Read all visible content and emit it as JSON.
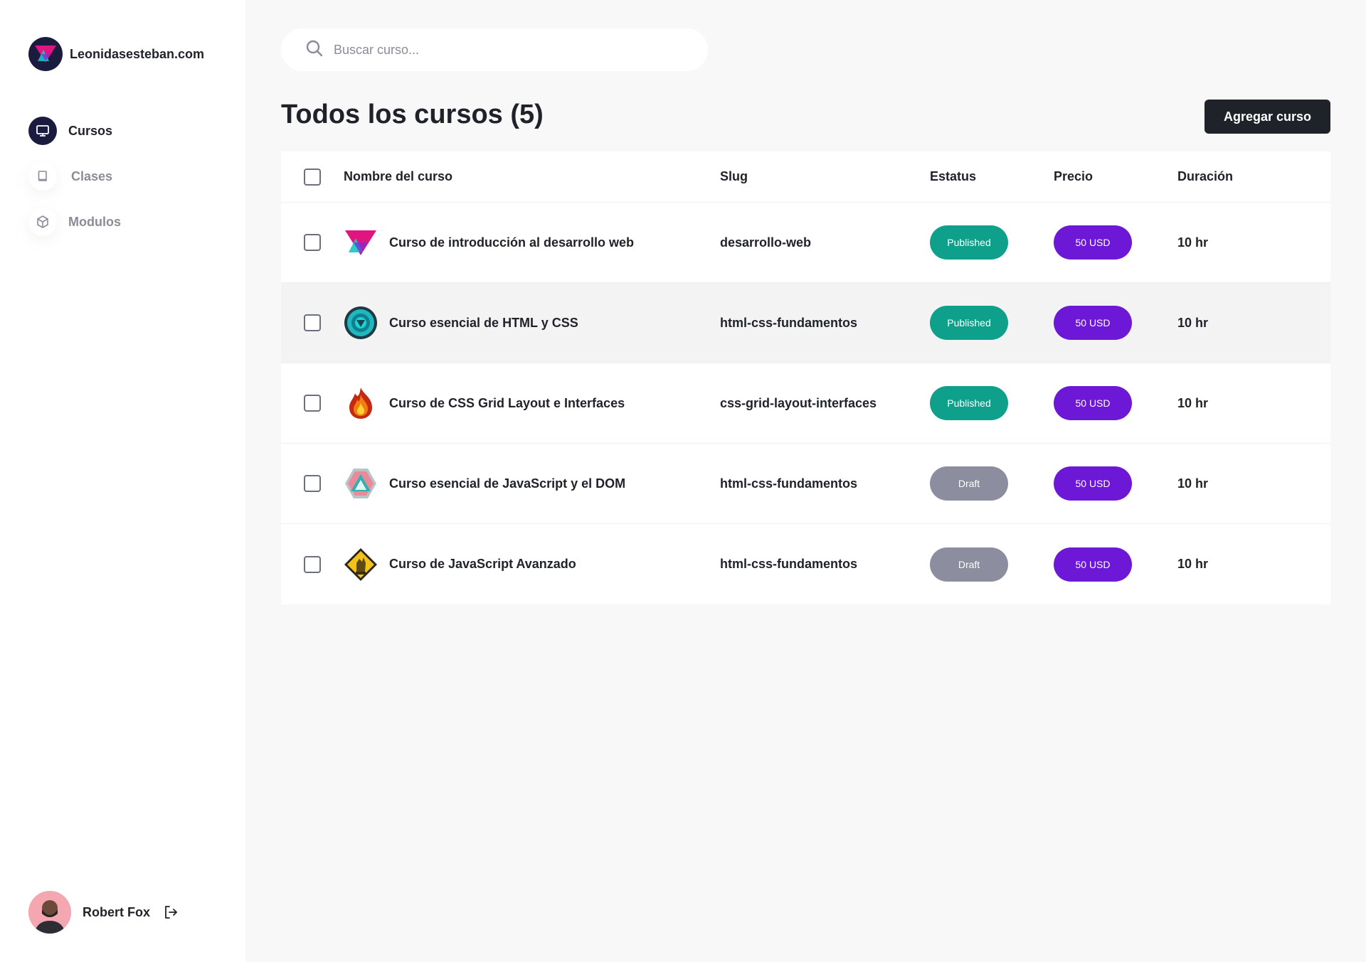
{
  "brand": {
    "name": "Leonidasesteban.com",
    "logo_icon": "triangle-logo-icon"
  },
  "nav": {
    "items": [
      {
        "label": "Cursos",
        "icon": "monitor-icon",
        "active": true
      },
      {
        "label": "Clases",
        "icon": "book-icon",
        "active": false
      },
      {
        "label": "Modulos",
        "icon": "cube-icon",
        "active": false
      }
    ]
  },
  "user": {
    "name": "Robert Fox",
    "logout_icon": "logout-icon"
  },
  "search": {
    "placeholder": "Buscar curso...",
    "value": ""
  },
  "page": {
    "title": "Todos los cursos (5)",
    "add_button": "Agregar curso"
  },
  "table": {
    "headers": {
      "name": "Nombre del curso",
      "slug": "Slug",
      "status": "Estatus",
      "price": "Precio",
      "duration": "Duración"
    },
    "rows": [
      {
        "name": "Curso de introducción al desarrollo web",
        "slug": "desarrollo-web",
        "status": "Published",
        "price": "50 USD",
        "duration": "10 hr",
        "icon": "triangle-badge-icon"
      },
      {
        "name": "Curso esencial de HTML y CSS",
        "slug": "html-css-fundamentos",
        "status": "Published",
        "price": "50 USD",
        "duration": "10 hr",
        "icon": "gear-badge-icon"
      },
      {
        "name": "Curso de CSS Grid Layout e Interfaces",
        "slug": "css-grid-layout-interfaces",
        "status": "Published",
        "price": "50 USD",
        "duration": "10 hr",
        "icon": "flame-badge-icon"
      },
      {
        "name": "Curso esencial de JavaScript y el DOM",
        "slug": "html-css-fundamentos",
        "status": "Draft",
        "price": "50 USD",
        "duration": "10 hr",
        "icon": "hexagon-badge-icon"
      },
      {
        "name": "Curso de JavaScript Avanzado",
        "slug": "html-css-fundamentos",
        "status": "Draft",
        "price": "50 USD",
        "duration": "10 hr",
        "icon": "diamond-badge-icon"
      }
    ]
  },
  "colors": {
    "published": "#0fa08c",
    "draft": "#8c8d9e",
    "price": "#6d18d6",
    "dark": "#1f2229",
    "nav_active": "#1a1b3f"
  }
}
